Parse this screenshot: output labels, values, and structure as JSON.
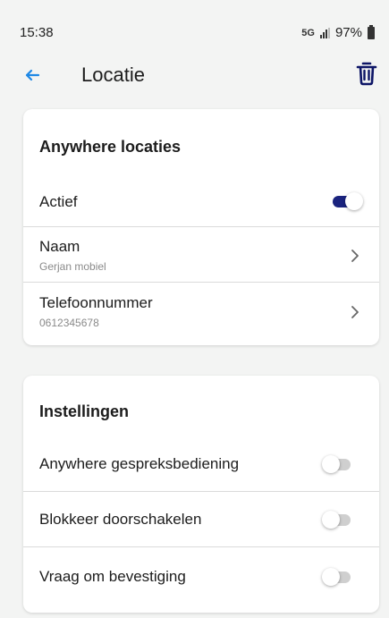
{
  "status_bar": {
    "time": "15:38",
    "network": "5G",
    "battery": "97%"
  },
  "header": {
    "title": "Locatie",
    "back_icon": "arrow-left-icon",
    "delete_icon": "trash-icon",
    "accent_color": "#1e88e5"
  },
  "location_card": {
    "title": "Anywhere locaties",
    "active": {
      "label": "Actief",
      "enabled": true
    },
    "name": {
      "label": "Naam",
      "value": "Gerjan mobiel"
    },
    "phone": {
      "label": "Telefoonnummer",
      "value": "0612345678"
    }
  },
  "settings_card": {
    "title": "Instellingen",
    "items": [
      {
        "label": "Anywhere gespreksbediening",
        "enabled": false
      },
      {
        "label": "Blokkeer doorschakelen",
        "enabled": false
      },
      {
        "label": "Vraag om bevestiging",
        "enabled": false
      }
    ]
  },
  "colors": {
    "toggle_on": "#1a237e",
    "toggle_off": "#cfcfcf",
    "background": "#f3f4f3",
    "icon_dark": "#0d1566"
  }
}
